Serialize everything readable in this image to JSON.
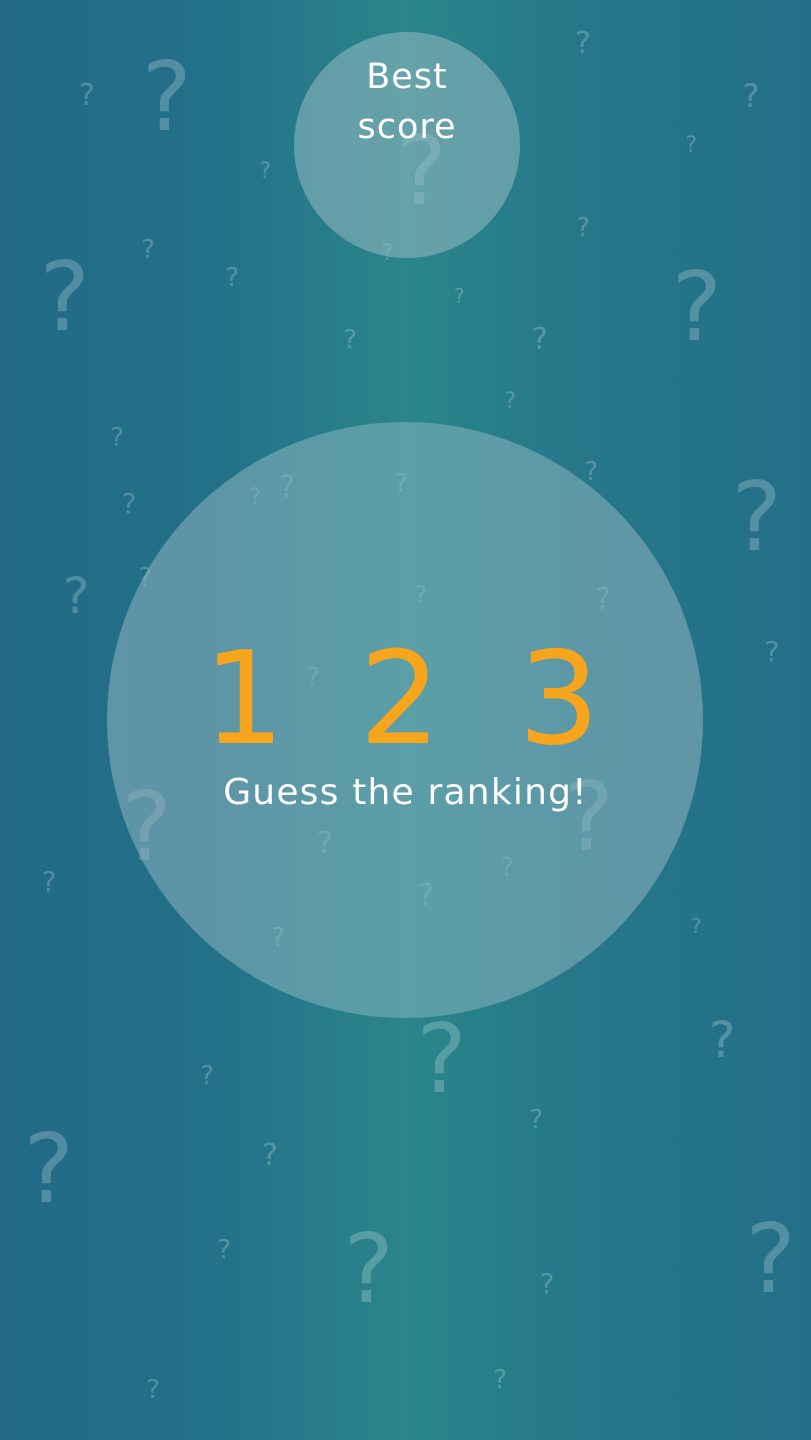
{
  "best_score": {
    "label": "Best\nscore"
  },
  "title_digits": [
    "1",
    "2",
    "3"
  ],
  "subtitle": "Guess the ranking!",
  "decoration_glyph": "?",
  "colors": {
    "digit": "#f7a51c",
    "text": "#ffffff",
    "background": "#2b858b"
  }
}
